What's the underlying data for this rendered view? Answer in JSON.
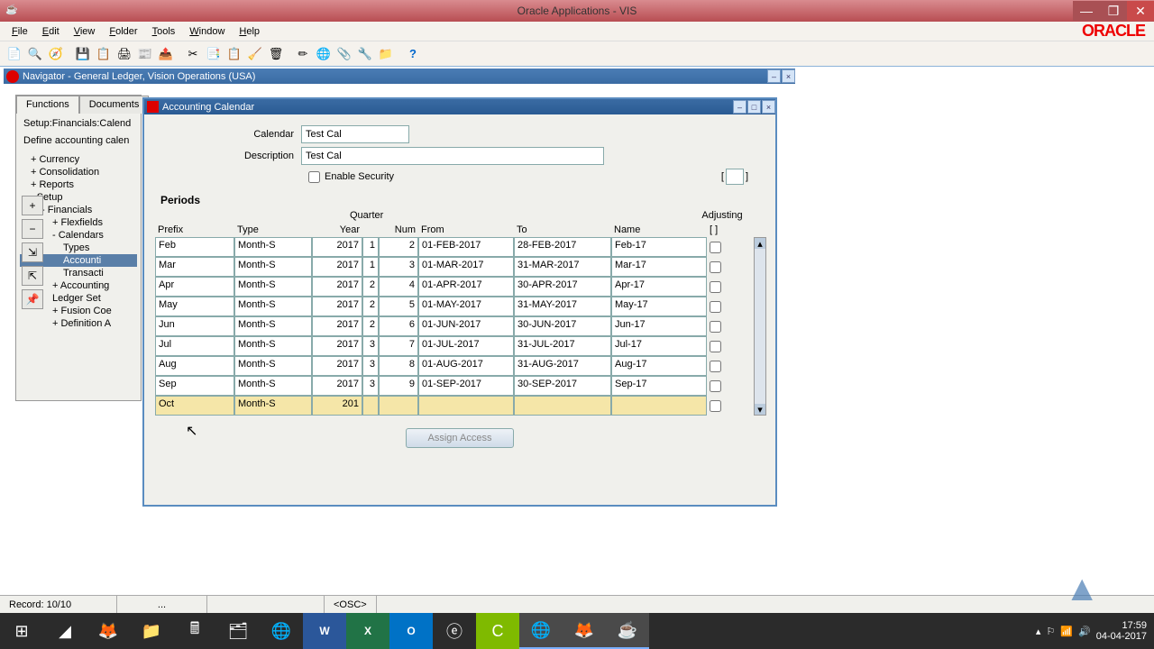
{
  "window": {
    "title": "Oracle Applications - VIS"
  },
  "menubar": {
    "items": [
      "File",
      "Edit",
      "View",
      "Folder",
      "Tools",
      "Window",
      "Help"
    ],
    "logo": "ORACLE"
  },
  "navigator": {
    "title": "Navigator - General Ledger, Vision Operations (USA)",
    "tabs": [
      "Functions",
      "Documents"
    ],
    "path": "Setup:Financials:Calend",
    "desc": "Define accounting calen",
    "tree": [
      {
        "l": 1,
        "p": "+",
        "t": "Currency"
      },
      {
        "l": 1,
        "p": "+",
        "t": "Consolidation"
      },
      {
        "l": 1,
        "p": "+",
        "t": "Reports"
      },
      {
        "l": 1,
        "p": "-",
        "t": "Setup"
      },
      {
        "l": 2,
        "p": "-",
        "t": "Financials"
      },
      {
        "l": 3,
        "p": "+",
        "t": "Flexfields"
      },
      {
        "l": 3,
        "p": "-",
        "t": "Calendars"
      },
      {
        "l": 4,
        "p": "",
        "t": "Types"
      },
      {
        "l": 4,
        "p": "",
        "t": "Accounti",
        "sel": true
      },
      {
        "l": 4,
        "p": "",
        "t": "Transacti"
      },
      {
        "l": 3,
        "p": "+",
        "t": "Accounting"
      },
      {
        "l": 3,
        "p": "",
        "t": "Ledger Set"
      },
      {
        "l": 3,
        "p": "+",
        "t": "Fusion Coe"
      },
      {
        "l": 3,
        "p": "+",
        "t": "Definition A"
      }
    ]
  },
  "calendar_window": {
    "title": "Accounting Calendar",
    "calendar_label": "Calendar",
    "calendar_value": "Test Cal",
    "description_label": "Description",
    "description_value": "Test Cal",
    "enable_security_label": "Enable Security",
    "periods_label": "Periods",
    "quarter_label": "Quarter",
    "adjusting_label": "Adjusting",
    "headers": {
      "prefix": "Prefix",
      "type": "Type",
      "year": "Year",
      "num": "Num",
      "from": "From",
      "to": "To",
      "name": "Name"
    },
    "rows": [
      {
        "prefix": "Feb",
        "type": "Month-S",
        "year": "2017",
        "q": "1",
        "num": "2",
        "from": "01-FEB-2017",
        "to": "28-FEB-2017",
        "name": "Feb-17"
      },
      {
        "prefix": "Mar",
        "type": "Month-S",
        "year": "2017",
        "q": "1",
        "num": "3",
        "from": "01-MAR-2017",
        "to": "31-MAR-2017",
        "name": "Mar-17"
      },
      {
        "prefix": "Apr",
        "type": "Month-S",
        "year": "2017",
        "q": "2",
        "num": "4",
        "from": "01-APR-2017",
        "to": "30-APR-2017",
        "name": "Apr-17"
      },
      {
        "prefix": "May",
        "type": "Month-S",
        "year": "2017",
        "q": "2",
        "num": "5",
        "from": "01-MAY-2017",
        "to": "31-MAY-2017",
        "name": "May-17"
      },
      {
        "prefix": "Jun",
        "type": "Month-S",
        "year": "2017",
        "q": "2",
        "num": "6",
        "from": "01-JUN-2017",
        "to": "30-JUN-2017",
        "name": "Jun-17"
      },
      {
        "prefix": "Jul",
        "type": "Month-S",
        "year": "2017",
        "q": "3",
        "num": "7",
        "from": "01-JUL-2017",
        "to": "31-JUL-2017",
        "name": "Jul-17"
      },
      {
        "prefix": "Aug",
        "type": "Month-S",
        "year": "2017",
        "q": "3",
        "num": "8",
        "from": "01-AUG-2017",
        "to": "31-AUG-2017",
        "name": "Aug-17"
      },
      {
        "prefix": "Sep",
        "type": "Month-S",
        "year": "2017",
        "q": "3",
        "num": "9",
        "from": "01-SEP-2017",
        "to": "30-SEP-2017",
        "name": "Sep-17"
      },
      {
        "prefix": "Oct",
        "type": "Month-S",
        "year": "201",
        "q": "",
        "num": "",
        "from": "",
        "to": "",
        "name": "",
        "active": true
      }
    ],
    "assign_button": "Assign Access"
  },
  "statusbar": {
    "record": "Record: 10/10",
    "ellipsis": "...",
    "osc": "<OSC>"
  },
  "taskbar": {
    "time": "17:59",
    "date": "04-04-2017"
  }
}
